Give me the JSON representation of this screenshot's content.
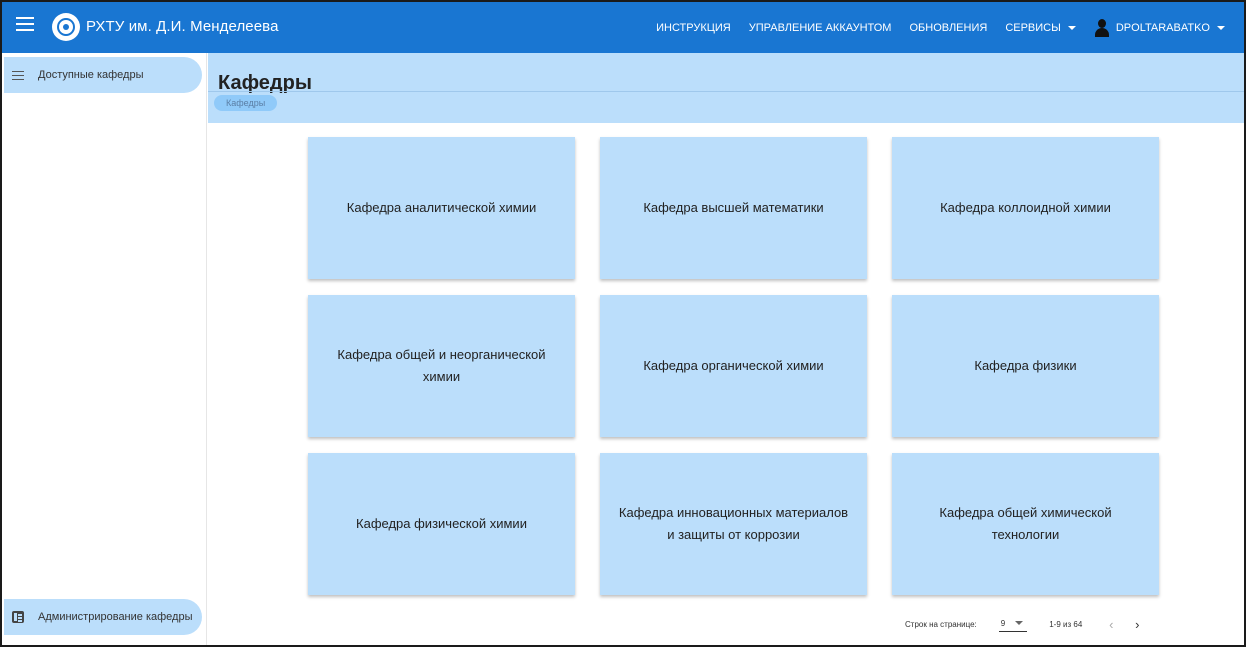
{
  "header": {
    "app_title": "РХТУ им. Д.И. Менделеева",
    "nav": [
      "ИНСТРУКЦИЯ",
      "УПРАВЛЕНИЕ АККАУНТОМ",
      "ОБНОВЛЕНИЯ"
    ],
    "services_label": "СЕРВИСЫ",
    "user_label": "DPOLTARABATKO"
  },
  "sidebar": {
    "top_item": "Доступные кафедры",
    "bottom_item": "Администрирование кафедры"
  },
  "page": {
    "title": "Кафедры",
    "breadcrumb": "Кафедры"
  },
  "cards": [
    "Кафедра аналитической химии",
    "Кафедра высшей математики",
    "Кафедра коллоидной химии",
    "Кафедра общей и неорганической химии",
    "Кафедра органической химии",
    "Кафедра физики",
    "Кафедра физической химии",
    "Кафедра инновационных материалов и защиты от коррозии",
    "Кафедра общей химической технологии"
  ],
  "pagination": {
    "rows_label": "Строк на странице:",
    "rows_value": "9",
    "range": "1-9 из 64",
    "prev_icon": "chevron-left-icon",
    "next_icon": "chevron-right-icon"
  },
  "colors": {
    "appbar": "#1976d2",
    "card": "#bbdefb",
    "header_band": "#bbdefb"
  }
}
